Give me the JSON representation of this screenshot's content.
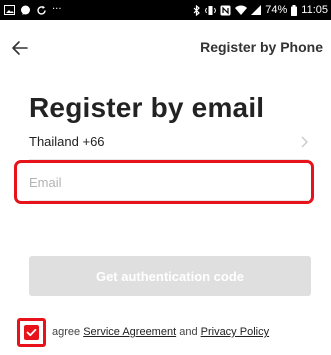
{
  "status_bar": {
    "battery_percent": "74%",
    "time": "11:05"
  },
  "nav": {
    "back_icon": "arrow-left-icon",
    "register_by_phone_label": "Register by Phone"
  },
  "title": "Register by email",
  "country": {
    "label": "Thailand +66",
    "chevron_icon": "chevron-right-icon"
  },
  "email": {
    "value": "",
    "placeholder": "Email"
  },
  "get_code_label": "Get authentication code",
  "agreement": {
    "checked": true,
    "prefix": "agree",
    "service_label": "Service Agreement",
    "and": "and",
    "privacy_label": "Privacy Policy"
  },
  "colors": {
    "accent": "#e8121a",
    "button_disabled": "#dfdfdf",
    "status_bar": "#000000"
  }
}
